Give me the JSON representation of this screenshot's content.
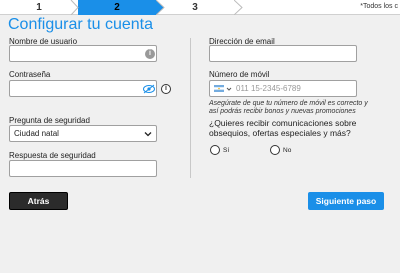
{
  "steps": [
    {
      "number": "1"
    },
    {
      "number": "2"
    },
    {
      "number": "3"
    }
  ],
  "required_note": "*Todos los c",
  "title": "Configurar tu cuenta",
  "left": {
    "username_label": "Nombre de usuario",
    "password_label": "Contraseña",
    "security_question_label": "Pregunta de seguridad",
    "security_question_value": "Ciudad natal",
    "security_answer_label": "Respuesta de seguridad"
  },
  "right": {
    "email_label": "Dirección de email",
    "mobile_label": "Número de móvil",
    "mobile_placeholder": "011 15-2345-6789",
    "mobile_note_line1": "Asegúrate de que tu número de móvil es correcto y",
    "mobile_note_line2": "así podrás recibir bonos y nuevas promociones",
    "offers_question_line1": "¿Quieres recibir comunicaciones sobre",
    "offers_question_line2": "obsequios, ofertas especiales y más?",
    "option_yes": "Sí",
    "option_no": "No"
  },
  "buttons": {
    "back": "Atrás",
    "next": "Siguiente paso"
  },
  "colors": {
    "accent": "#1a8fe8",
    "back_button": "#2b2b2b"
  }
}
